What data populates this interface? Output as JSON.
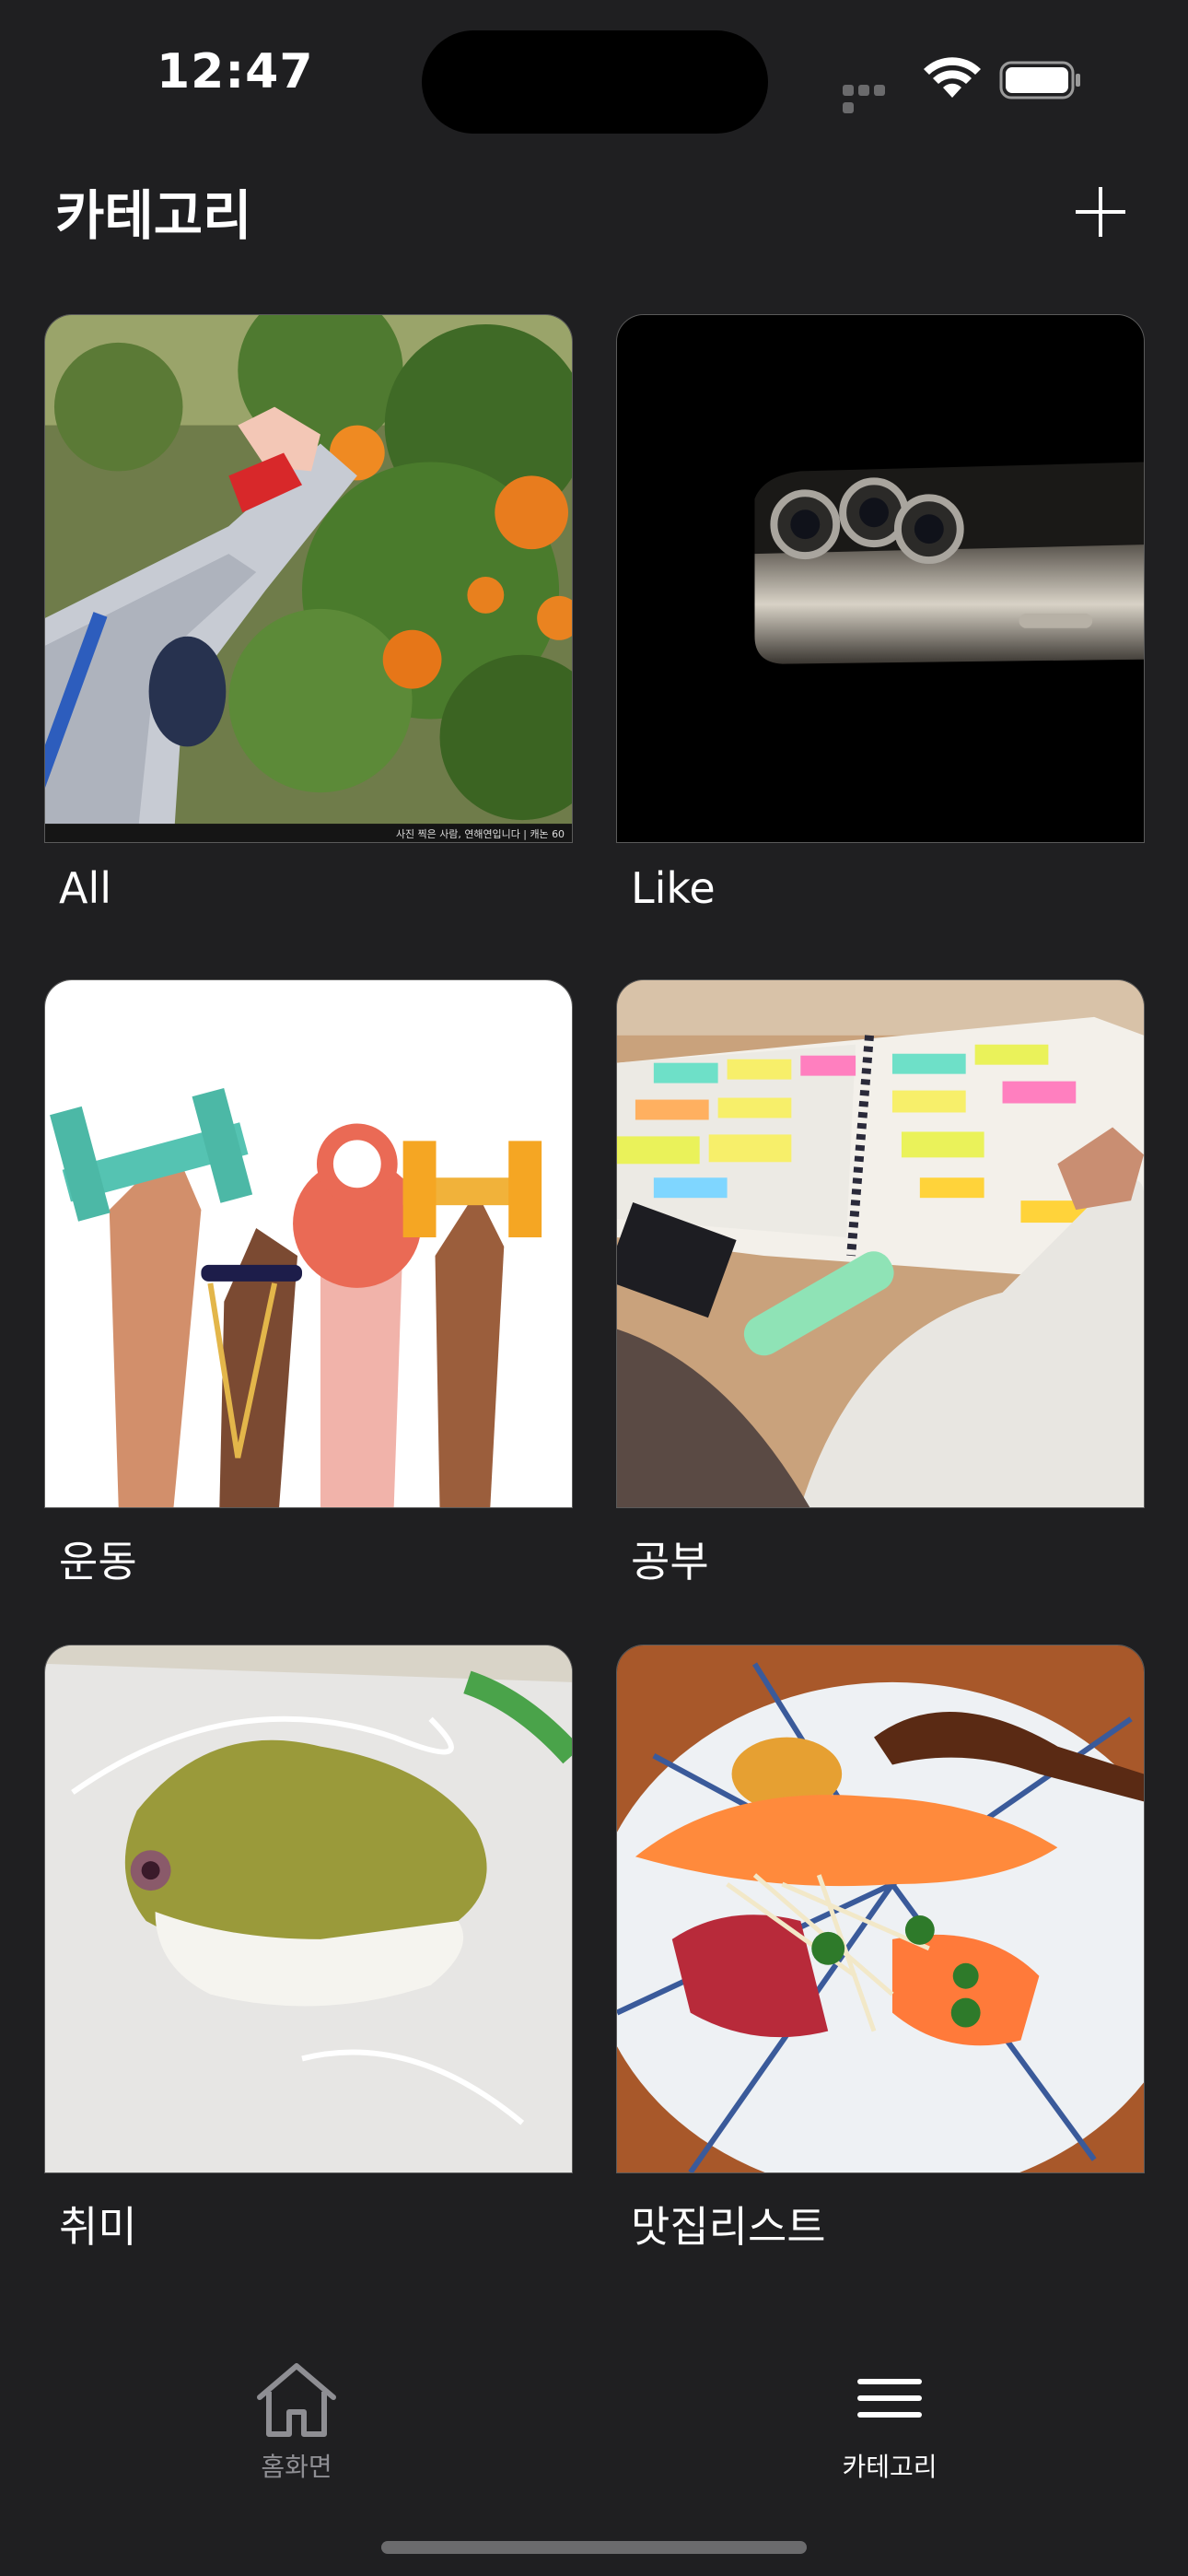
{
  "status_bar": {
    "time": "12:47"
  },
  "header": {
    "title": "카테고리"
  },
  "categories": [
    {
      "label": "All",
      "photo_caption": "사진 찍은 사람, 연해연입니다 | 캐논 60"
    },
    {
      "label": "Like"
    },
    {
      "label": "운동"
    },
    {
      "label": "공부"
    },
    {
      "label": "취미"
    },
    {
      "label": "맛집리스트"
    }
  ],
  "tab_bar": {
    "items": [
      {
        "label": "홈화면",
        "icon": "home-icon",
        "selected": false
      },
      {
        "label": "카테고리",
        "icon": "menu-icon",
        "selected": true
      }
    ]
  },
  "colors": {
    "background": "#1f1f21",
    "tab_inactive": "#8e8e93",
    "tab_active": "#ffffff"
  }
}
